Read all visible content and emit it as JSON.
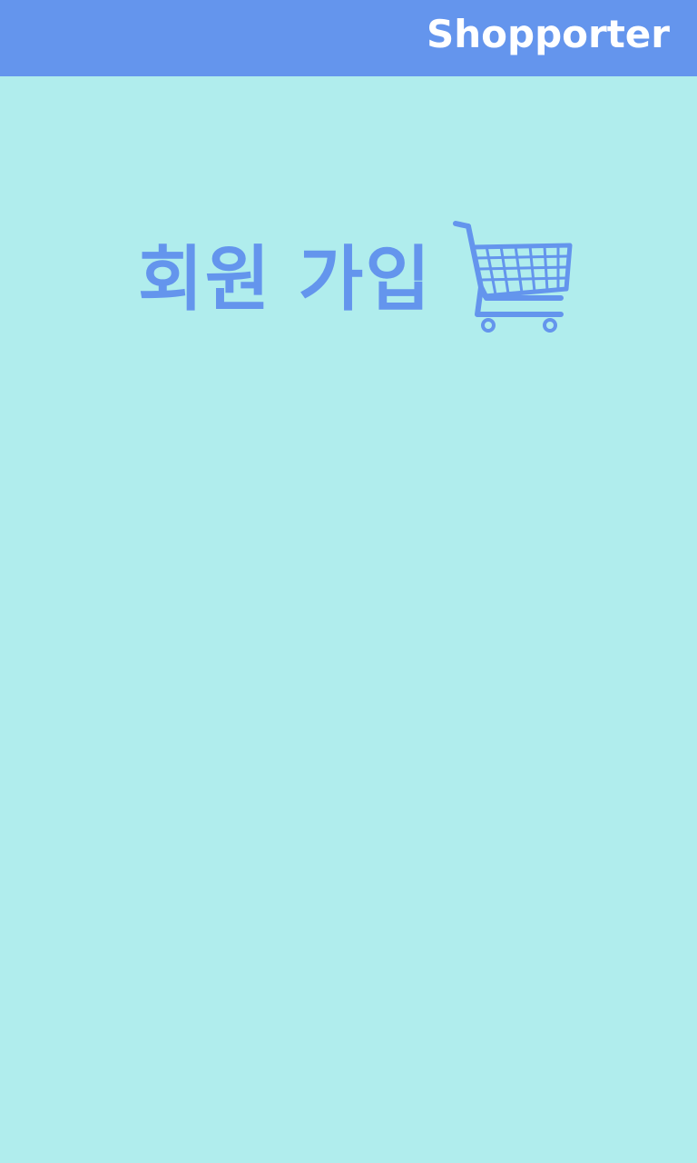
{
  "app_bar": {
    "title": "Shopporter",
    "background_color": "#6495ed"
  },
  "main": {
    "page_title": "회원 가입",
    "title_icon": "shopping-cart-icon",
    "background_color": "#b0eded",
    "accent_color": "#6495ed"
  }
}
